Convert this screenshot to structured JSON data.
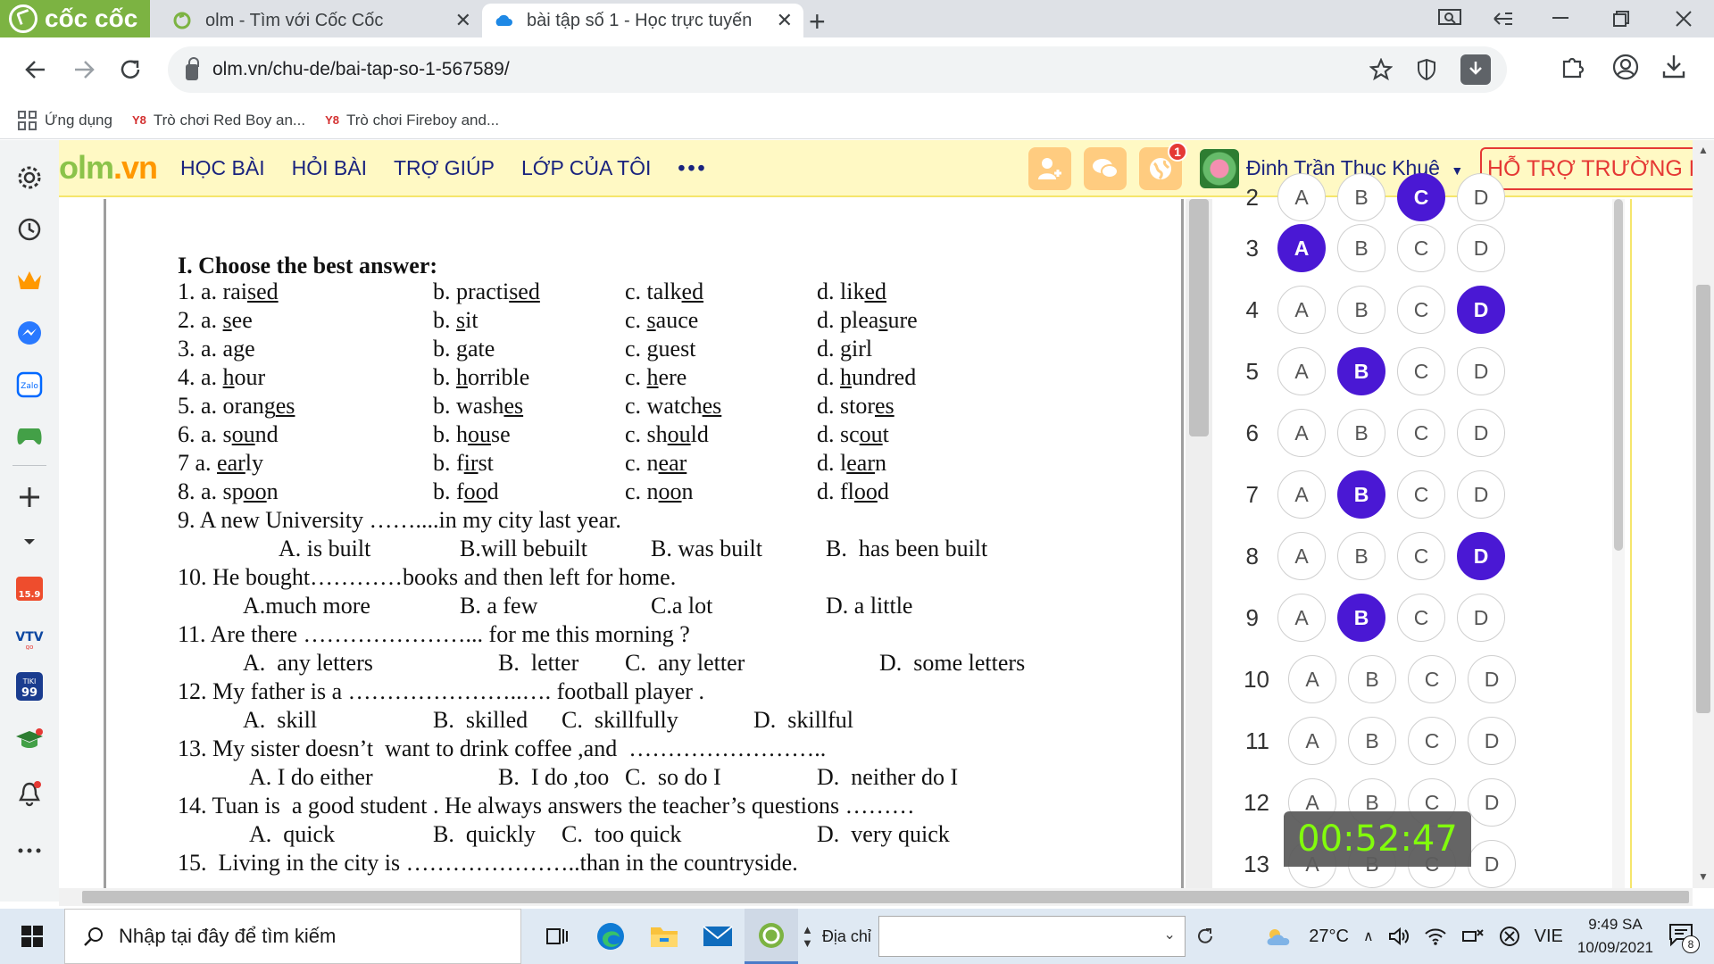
{
  "browser": {
    "brand": "cốc cốc",
    "tabs": [
      {
        "title": "olm - Tìm với Cốc Cốc",
        "close": "✕"
      },
      {
        "title": "bài tập số 1 - Học trực tuyến",
        "close": "✕"
      }
    ],
    "new_tab": "+",
    "url": "olm.vn/chu-de/bai-tap-so-1-567589/"
  },
  "bookmarks": [
    {
      "label": "Ứng dụng"
    },
    {
      "label": "Trò chơi Red Boy an..."
    },
    {
      "label": "Trò chơi Fireboy and..."
    }
  ],
  "olm": {
    "logo_left": "olm",
    "logo_right": ".vn",
    "nav": [
      "HỌC BÀI",
      "HỎI BÀI",
      "TRỢ GIÚP",
      "LỚP CỦA TÔI"
    ],
    "nav_more": "•••",
    "notif_count": "1",
    "user_name": "Đinh Trần Thục Khuê",
    "support": "HỖ TRỢ TRƯỜNG HỌ"
  },
  "doc": {
    "heading": "I. Choose the best answer:",
    "timer": "00:52:47"
  },
  "answers": [
    {
      "num": "2",
      "selected": "C"
    },
    {
      "num": "3",
      "selected": "A"
    },
    {
      "num": "4",
      "selected": "D"
    },
    {
      "num": "5",
      "selected": "B"
    },
    {
      "num": "6",
      "selected": ""
    },
    {
      "num": "7",
      "selected": "B"
    },
    {
      "num": "8",
      "selected": "D"
    },
    {
      "num": "9",
      "selected": "B"
    },
    {
      "num": "10",
      "selected": ""
    },
    {
      "num": "11",
      "selected": ""
    },
    {
      "num": "12",
      "selected": ""
    },
    {
      "num": "13",
      "selected": ""
    }
  ],
  "taskbar": {
    "search_placeholder": "Nhập tại đây để tìm kiếm",
    "address_label": "Địa chỉ",
    "temperature": "27°C",
    "language": "VIE",
    "time": "9:49 SA",
    "date": "10/09/2021",
    "notifications": "8"
  }
}
